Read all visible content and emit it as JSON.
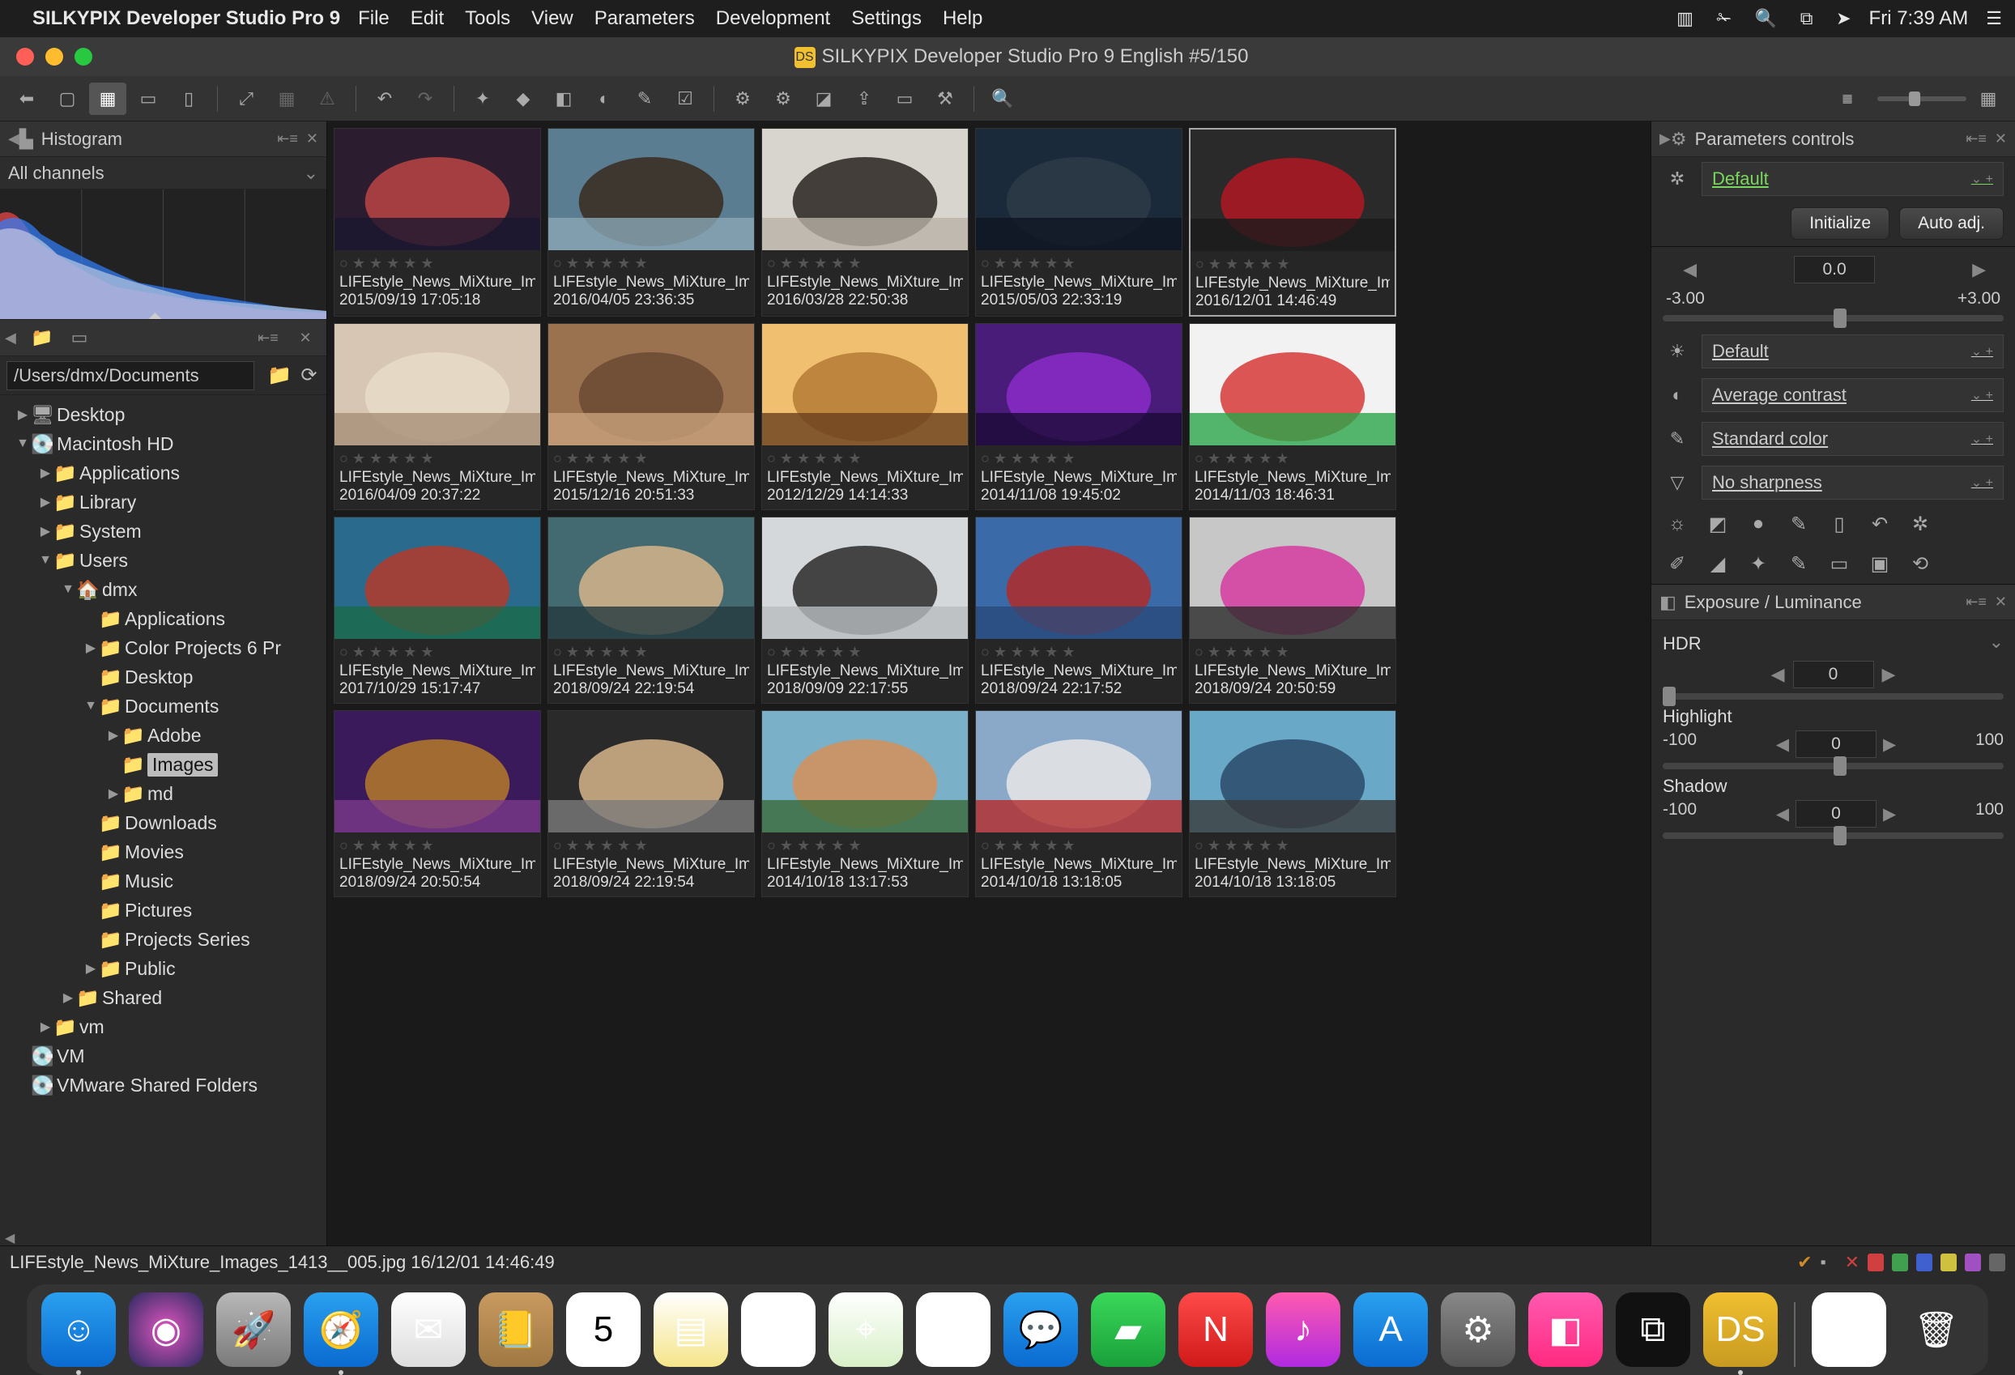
{
  "menubar": {
    "app": "SILKYPIX Developer Studio Pro 9",
    "items": [
      "File",
      "Edit",
      "Tools",
      "View",
      "Parameters",
      "Development",
      "Settings",
      "Help"
    ],
    "clock": "Fri 7:39 AM"
  },
  "window": {
    "title": "SILKYPIX Developer Studio Pro 9 English  #5/150"
  },
  "left": {
    "histogram_title": "Histogram",
    "channels": "All channels",
    "path": "/Users/dmx/Documents",
    "tree": [
      {
        "d": 0,
        "a": "▶",
        "i": "desk",
        "t": "Desktop"
      },
      {
        "d": 0,
        "a": "▼",
        "i": "disk",
        "t": "Macintosh HD"
      },
      {
        "d": 1,
        "a": "▶",
        "i": "f",
        "t": "Applications"
      },
      {
        "d": 1,
        "a": "▶",
        "i": "f",
        "t": "Library"
      },
      {
        "d": 1,
        "a": "▶",
        "i": "f",
        "t": "System"
      },
      {
        "d": 1,
        "a": "▼",
        "i": "f",
        "t": "Users"
      },
      {
        "d": 2,
        "a": "▼",
        "i": "h",
        "t": "dmx"
      },
      {
        "d": 3,
        "a": "",
        "i": "f",
        "t": "Applications"
      },
      {
        "d": 3,
        "a": "▶",
        "i": "f",
        "t": "Color Projects 6 Pr"
      },
      {
        "d": 3,
        "a": "",
        "i": "f",
        "t": "Desktop"
      },
      {
        "d": 3,
        "a": "▼",
        "i": "f",
        "t": "Documents"
      },
      {
        "d": 4,
        "a": "▶",
        "i": "f",
        "t": "Adobe"
      },
      {
        "d": 4,
        "a": "",
        "i": "f",
        "t": "Images",
        "sel": true
      },
      {
        "d": 4,
        "a": "▶",
        "i": "f",
        "t": "md"
      },
      {
        "d": 3,
        "a": "",
        "i": "f",
        "t": "Downloads"
      },
      {
        "d": 3,
        "a": "",
        "i": "f",
        "t": "Movies"
      },
      {
        "d": 3,
        "a": "",
        "i": "f",
        "t": "Music"
      },
      {
        "d": 3,
        "a": "",
        "i": "f",
        "t": "Pictures"
      },
      {
        "d": 3,
        "a": "",
        "i": "f",
        "t": "Projects Series"
      },
      {
        "d": 3,
        "a": "▶",
        "i": "f",
        "t": "Public"
      },
      {
        "d": 2,
        "a": "▶",
        "i": "f",
        "t": "Shared"
      },
      {
        "d": 1,
        "a": "▶",
        "i": "f",
        "t": "vm"
      },
      {
        "d": 0,
        "a": "",
        "i": "disk",
        "t": "VM"
      },
      {
        "d": 0,
        "a": "",
        "i": "disk",
        "t": "VMware Shared Folders"
      }
    ]
  },
  "thumbs": [
    {
      "name": "LIFEstyle_News_MiXture_Image",
      "date": "2015/09/19 17:05:18",
      "c": [
        "#2b1d2f",
        "#b44",
        "#1a1730"
      ]
    },
    {
      "name": "LIFEstyle_News_MiXture_Image",
      "date": "2016/04/05 23:36:35",
      "c": [
        "#5a7d92",
        "#3a2a1e",
        "#8aa6b5"
      ]
    },
    {
      "name": "LIFEstyle_News_MiXture_Image",
      "date": "2016/03/28 22:50:38",
      "c": [
        "#d8d5cf",
        "#2a2320",
        "#b9b2a8"
      ]
    },
    {
      "name": "LIFEstyle_News_MiXture_Image",
      "date": "2015/05/03 22:33:19",
      "c": [
        "#1b2a3a",
        "#2d3a48",
        "#0e1520"
      ]
    },
    {
      "name": "LIFEstyle_News_MiXture_Image",
      "date": "2016/12/01 14:46:49",
      "sel": true,
      "c": [
        "#2a2a2a",
        "#b01822",
        "#1a1a1a"
      ]
    },
    {
      "name": "LIFEstyle_News_MiXture_Image",
      "date": "2016/04/09 20:37:22",
      "c": [
        "#d7c6b3",
        "#e7dcc9",
        "#a88f78"
      ]
    },
    {
      "name": "LIFEstyle_News_MiXture_Image",
      "date": "2015/12/16 20:51:33",
      "c": [
        "#9a7250",
        "#6b4a34",
        "#c8a07a"
      ]
    },
    {
      "name": "LIFEstyle_News_MiXture_Image",
      "date": "2012/12/29 14:14:33",
      "c": [
        "#f0c070",
        "#b47a34",
        "#6a3f1e"
      ]
    },
    {
      "name": "LIFEstyle_News_MiXture_Image",
      "date": "2014/11/08 19:45:02",
      "c": [
        "#4a1c7a",
        "#8a2cc8",
        "#1a0a36"
      ]
    },
    {
      "name": "LIFEstyle_News_MiXture_Image",
      "date": "2014/11/03 18:46:31",
      "c": [
        "#f2f2f2",
        "#d83a3a",
        "#2aa54a"
      ]
    },
    {
      "name": "LIFEstyle_News_MiXture_Image",
      "date": "2017/10/29 15:17:47",
      "c": [
        "#2a6a8d",
        "#b53a2a",
        "#1a6a48"
      ]
    },
    {
      "name": "LIFEstyle_News_MiXture_Image",
      "date": "2018/09/24 22:19:54",
      "c": [
        "#426a70",
        "#d6b48a",
        "#243a40"
      ]
    },
    {
      "name": "LIFEstyle_News_MiXture_Image",
      "date": "2018/09/09 22:17:55",
      "c": [
        "#d4d8da",
        "#2a2a2a",
        "#b8bdbf"
      ]
    },
    {
      "name": "LIFEstyle_News_MiXture_Image",
      "date": "2018/09/24 22:17:52",
      "c": [
        "#3a6aa8",
        "#b22a2a",
        "#2a4a7a"
      ]
    },
    {
      "name": "LIFEstyle_News_MiXture_Image",
      "date": "2018/09/24 20:50:59",
      "c": [
        "#c7c7c7",
        "#d63aa0",
        "#2a2a2a"
      ]
    },
    {
      "name": "LIFEstyle_News_MiXture_Image",
      "date": "2018/09/24 20:50:54",
      "c": [
        "#3a1a5a",
        "#b47a2a",
        "#7a3a8a"
      ]
    },
    {
      "name": "LIFEstyle_News_MiXture_Image",
      "date": "2018/09/24 22:19:54",
      "c": [
        "#2a2a2a",
        "#d6b48a",
        "#7a7a7a"
      ]
    },
    {
      "name": "LIFEstyle_News_MiXture_Image",
      "date": "2014/10/18 13:17:53",
      "c": [
        "#7ab0c8",
        "#d6905a",
        "#3a6a3a"
      ]
    },
    {
      "name": "LIFEstyle_News_MiXture_Image",
      "date": "2014/10/18 13:18:05",
      "c": [
        "#8aa8c8",
        "#e8e8e8",
        "#b22a2a"
      ]
    },
    {
      "name": "LIFEstyle_News_MiXture_Image",
      "date": "2014/10/18 13:18:05",
      "c": [
        "#6aa8c8",
        "#2a4a6a",
        "#3a3a3a"
      ]
    }
  ],
  "right": {
    "params_title": "Parameters controls",
    "preset": "Default",
    "btn_init": "Initialize",
    "btn_auto": "Auto adj.",
    "exp_val": "0.0",
    "exp_min": "-3.00",
    "exp_max": "+3.00",
    "wb": "Default",
    "contrast": "Average contrast",
    "color": "Standard color",
    "sharp": "No sharpness",
    "sub_title": "Exposure / Luminance",
    "hdr_label": "HDR",
    "hdr_val": "0",
    "hl_label": "Highlight",
    "hl_min": "-100",
    "hl_val": "0",
    "hl_max": "100",
    "sh_label": "Shadow",
    "sh_min": "-100",
    "sh_val": "0",
    "sh_max": "100"
  },
  "status": {
    "file": "LIFEstyle_News_MiXture_Images_1413__005.jpg 16/12/01 14:46:49"
  },
  "dock": [
    {
      "n": "finder",
      "g": "☺",
      "bg": "linear-gradient(#2aa0ef,#0a6ad0)",
      "dot": true
    },
    {
      "n": "siri",
      "g": "◉",
      "bg": "radial-gradient(circle,#e055c0,#2a2a60)"
    },
    {
      "n": "launchpad",
      "g": "🚀",
      "bg": "linear-gradient(#b8b8b8,#7a7a7a)"
    },
    {
      "n": "safari",
      "g": "🧭",
      "bg": "linear-gradient(#2aa0ef,#0a6ad0)",
      "dot": true
    },
    {
      "n": "mail",
      "g": "✉",
      "bg": "linear-gradient(#fff,#ddd)"
    },
    {
      "n": "contacts",
      "g": "📒",
      "bg": "linear-gradient(#c89a60,#a07842)"
    },
    {
      "n": "calendar",
      "g": "5",
      "bg": "#fff",
      "fg": "#000"
    },
    {
      "n": "notes",
      "g": "▤",
      "bg": "linear-gradient(#fff,#f5e58a)"
    },
    {
      "n": "reminders",
      "g": "▥",
      "bg": "#fff"
    },
    {
      "n": "maps",
      "g": "⌖",
      "bg": "linear-gradient(#fff,#d8f0c8)"
    },
    {
      "n": "photos",
      "g": "✿",
      "bg": "#fff"
    },
    {
      "n": "messages",
      "g": "💬",
      "bg": "linear-gradient(#2aa0ef,#0a6ad0)"
    },
    {
      "n": "facetime",
      "g": "▰",
      "bg": "linear-gradient(#3ad85a,#1aa03a)"
    },
    {
      "n": "news",
      "g": "N",
      "bg": "linear-gradient(#ff4a4a,#d01a1a)"
    },
    {
      "n": "itunes",
      "g": "♪",
      "bg": "linear-gradient(#ff5ab0,#b02ae0)"
    },
    {
      "n": "appstore",
      "g": "A",
      "bg": "linear-gradient(#2aa0ef,#0a6ad0)"
    },
    {
      "n": "sysprefs",
      "g": "⚙",
      "bg": "linear-gradient(#888,#555)"
    },
    {
      "n": "cleanmymac",
      "g": "◧",
      "bg": "linear-gradient(#ff5ab0,#ff2a80)"
    },
    {
      "n": "activity",
      "g": "⧉",
      "bg": "#111"
    },
    {
      "n": "silkypix",
      "g": "DS",
      "bg": "linear-gradient(#f0c030,#c89a20)",
      "dot": true
    },
    {
      "n": "sep"
    },
    {
      "n": "docs",
      "g": "▥",
      "bg": "#fff"
    },
    {
      "n": "trash",
      "g": "🗑",
      "bg": "transparent"
    }
  ]
}
